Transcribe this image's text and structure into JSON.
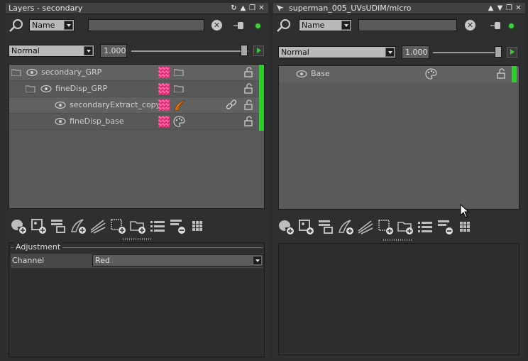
{
  "left": {
    "title": "Layers - secondary",
    "search_field": "Name",
    "blend_mode": "Normal",
    "opacity": "1.000",
    "layers": [
      {
        "name": "secondary_GRP"
      },
      {
        "name": "fineDisp_GRP"
      },
      {
        "name": "secondaryExtract_copy"
      },
      {
        "name": "fineDisp_base"
      }
    ],
    "adjustment": {
      "title": "Adjustment",
      "channel_label": "Channel",
      "channel_value": "Red"
    }
  },
  "right": {
    "title": "superman_005_UVsUDIM/micro",
    "search_field": "Name",
    "blend_mode": "Normal",
    "opacity": "1.000",
    "layers": [
      {
        "name": "Base"
      }
    ]
  },
  "colors": {
    "mask": "#d6216e",
    "active_indicator": "#22d622",
    "status_dot": "#3ed03e"
  }
}
